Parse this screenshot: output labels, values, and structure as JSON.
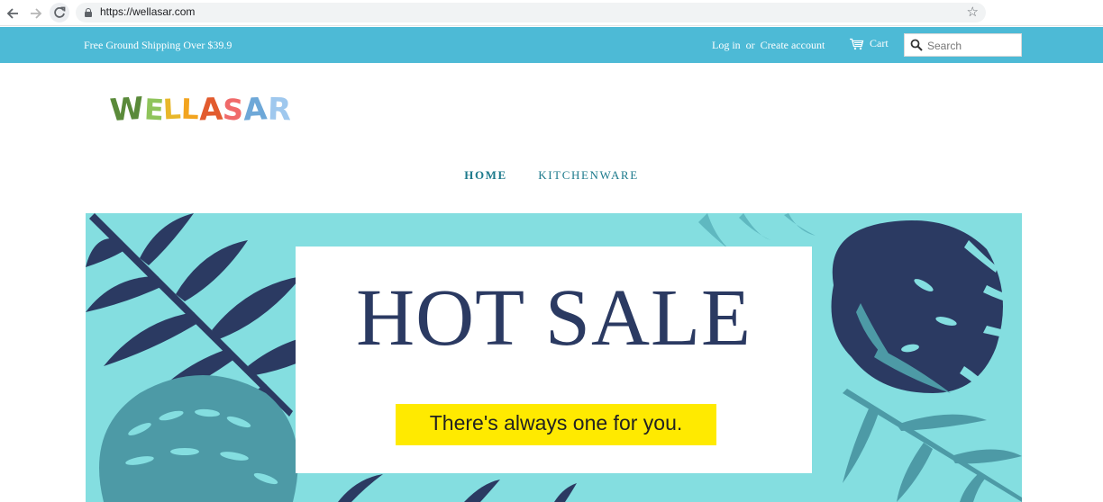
{
  "browser": {
    "url": "https://wellasar.com",
    "icons": {
      "back": "arrow-left-icon",
      "forward": "arrow-right-icon",
      "reload": "reload-icon",
      "lock": "lock-icon",
      "bookmark": "star-icon"
    }
  },
  "header": {
    "shipping_message": "Free Ground Shipping Over $39.9",
    "login_label": "Log in",
    "or_label": "or",
    "create_account_label": "Create account",
    "cart_label": "Cart",
    "search_placeholder": "Search",
    "colors": {
      "bar": "#4dbad6",
      "text": "#ffffff"
    }
  },
  "logo": {
    "text": "WELLASAR",
    "letters": [
      "W",
      "E",
      "L",
      "L",
      "A",
      "S",
      "A",
      "R"
    ]
  },
  "nav": {
    "items": [
      {
        "label": "HOME",
        "active": true
      },
      {
        "label": "KITCHENWARE",
        "active": false
      }
    ],
    "color": "#1d7a8c"
  },
  "hero": {
    "title": "HOT SALE",
    "tagline": "There's always one for you.",
    "colors": {
      "background": "#84dee0",
      "leaf_dark": "#2b3a62",
      "leaf_teal": "#4d9aa6",
      "title": "#2b3a62",
      "tagline_bg": "#ffea00"
    }
  }
}
